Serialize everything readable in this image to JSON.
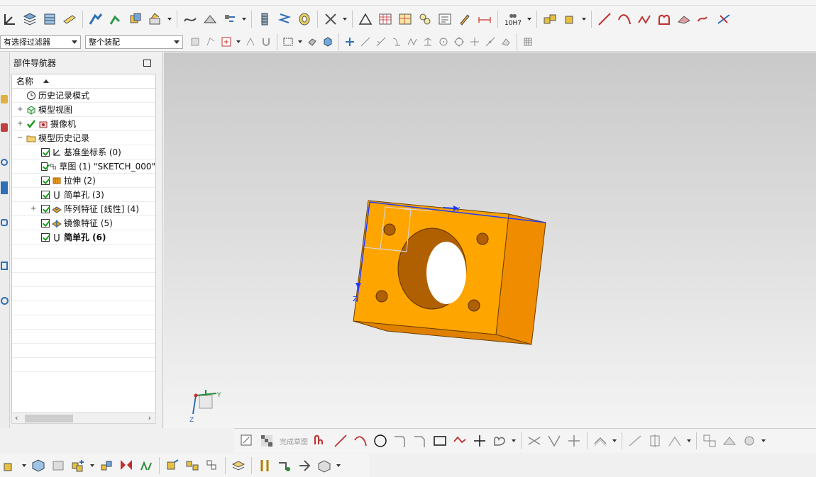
{
  "filters": {
    "selection_filter": "有选择过滤器",
    "assembly_scope": "整个装配"
  },
  "navigator": {
    "title": "部件导航器",
    "column_header": "名称",
    "rows": [
      {
        "label": "历史记录模式",
        "icon": "clock-icon"
      },
      {
        "label": "模型视图",
        "icon": "model-view-icon"
      },
      {
        "label": "摄像机",
        "icon": "camera-icon"
      },
      {
        "label": "模型历史记录",
        "icon": "folder-icon"
      },
      {
        "label": "基准坐标系 (0)",
        "icon": "datum-csys-icon"
      },
      {
        "label": "草图 (1) \"SKETCH_000\"",
        "icon": "sketch-icon"
      },
      {
        "label": "拉伸 (2)",
        "icon": "extrude-icon"
      },
      {
        "label": "简单孔 (3)",
        "icon": "hole-icon"
      },
      {
        "label": "阵列特征 [线性] (4)",
        "icon": "pattern-icon"
      },
      {
        "label": "镜像特征 (5)",
        "icon": "mirror-icon"
      },
      {
        "label": "简单孔 (6)",
        "icon": "hole-icon"
      }
    ]
  },
  "sketch_toolbar": {
    "finish_sketch_label": "完成草图"
  },
  "toolbar": {
    "tolerance_label": "10H7"
  },
  "viewport": {
    "axis_y": "Y",
    "axis_z": "Z",
    "triad_y": "Y",
    "triad_z": "Z"
  },
  "colors": {
    "part_front": "#ffa500",
    "part_side": "#f08c00",
    "sketch_line": "#1f3cff",
    "check_green": "#1a9a1a"
  }
}
